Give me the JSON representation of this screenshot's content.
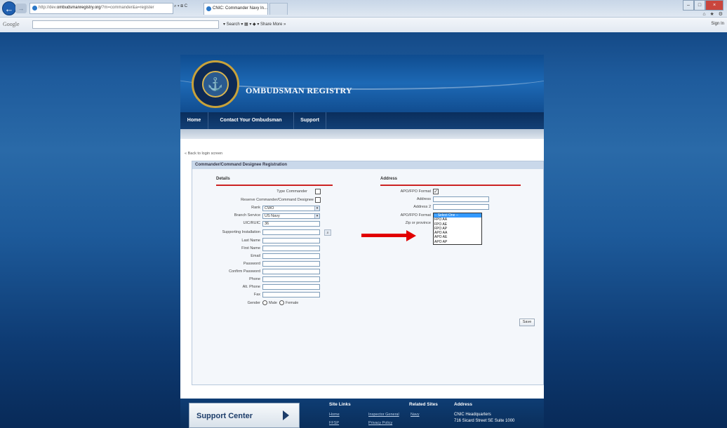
{
  "browser": {
    "url_prefix": "http://dev.",
    "url_domain": "ombudsmanregistry.org",
    "url_path": "/?m=commander&a=register",
    "addr_controls": "⌕ ▾ ⊠ C",
    "tab_title": "CNIC: Commander Navy In...",
    "tab_close": "×",
    "google_label": "Google",
    "toolbar_text": "▾  Search ▾   ▦ ▾  ◆ ▾    Share   More »",
    "sign_in": "Sign In",
    "right_icons": "⌂ ★ ⚙",
    "win_min": "–",
    "win_max": "□",
    "win_close": "×"
  },
  "site": {
    "title": "OMBUDSMAN REGISTRY",
    "nav": [
      "Home",
      "Contact Your Ombudsman",
      "Support"
    ]
  },
  "form": {
    "back_link": "« Back to login screen",
    "panel_title": "Commander/Command Designee Registration",
    "details_title": "Details",
    "address_title": "Address",
    "labels": {
      "type_commander": "Type Commander",
      "reserve": "Reserve Commander/Command Designee",
      "rank": "Rank",
      "branch": "Branch Service",
      "uic": "UIC/RUIC",
      "installation": "Supporting Installation",
      "last_name": "Last Name",
      "first_name": "First Name",
      "email": "Email",
      "password": "Password",
      "confirm_password": "Confirm Password",
      "phone": "Phone",
      "alt_phone": "Alt. Phone",
      "fax": "Fax",
      "gender": "Gender",
      "male": "Male",
      "female": "Female",
      "apo_format": "APO/FPO Format",
      "address": "Address",
      "address2": "Address 2",
      "apo_format2": "APO/FPO Format",
      "zip": "Zip or province"
    },
    "values": {
      "rank": "CWO",
      "branch": "US Navy",
      "uic": "36",
      "type_commander_checked": false,
      "reserve_checked": false,
      "apo_checked": true
    },
    "dropdown_options": [
      "-- Select One --",
      "FPO AA",
      "FPO AE",
      "FPO AP",
      "APO AA",
      "APO AE",
      "APO AP"
    ],
    "dropdown_selected": 0,
    "check_mark": "✓",
    "select_arrow": "▾",
    "lookup_icon": "⌕",
    "save_label": "Save"
  },
  "footer": {
    "support_center": "Support Center",
    "site_links_title": "Site Links",
    "related_title": "Related Sites",
    "address_title": "Address",
    "site_links": [
      "Home",
      "FFSP"
    ],
    "related_links": [
      "Inspector General",
      "Privacy Policy"
    ],
    "navy_link": "Navy",
    "address_lines": [
      "CNIC Headquarters",
      "716 Sicard Street SE Suite 1000"
    ]
  },
  "colors": {
    "accent_red": "#cc2222",
    "arrow_red": "#e10000",
    "nav_blue": "#0a2e5c"
  }
}
